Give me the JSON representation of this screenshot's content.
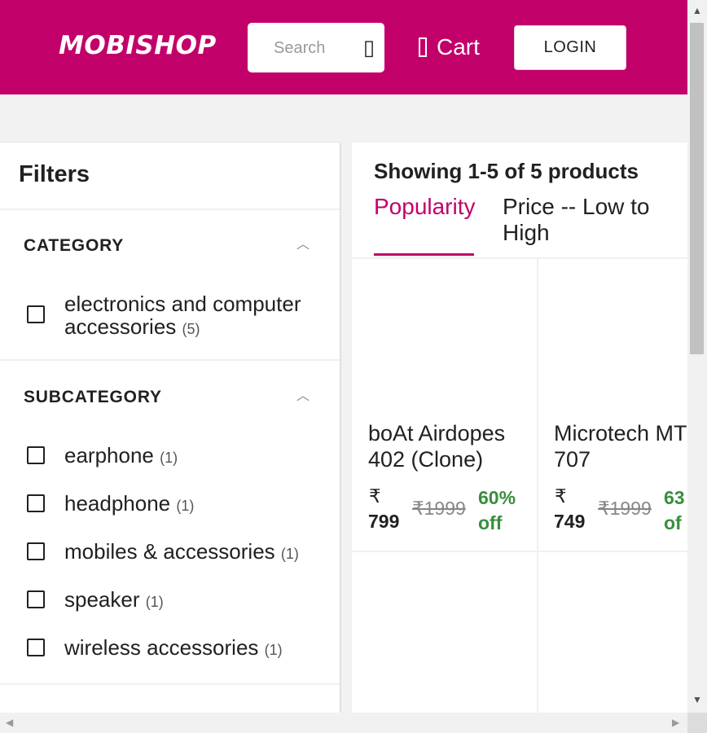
{
  "header": {
    "logo": "MOBISHOP",
    "search_placeholder": "Search",
    "search_icon_glyph": "▯",
    "cart_label": "Cart",
    "login_label": "LOGIN",
    "brand_color": "#c2006a"
  },
  "filters": {
    "title": "Filters",
    "category": {
      "title": "CATEGORY",
      "options": [
        {
          "line1": "electronics and computer",
          "line2": "accessories",
          "count": "(5)"
        }
      ]
    },
    "subcategory": {
      "title": "SUBCATEGORY",
      "options": [
        {
          "label": "earphone",
          "count": "(1)"
        },
        {
          "label": "headphone",
          "count": "(1)"
        },
        {
          "label": "mobiles & accessories",
          "count": "(1)"
        },
        {
          "label": "speaker",
          "count": "(1)"
        },
        {
          "label": "wireless accessories",
          "count": "(1)"
        }
      ]
    }
  },
  "products": {
    "showing": "Showing 1-5 of 5 products",
    "sort_tabs": [
      "Popularity",
      "Price -- Low to High"
    ],
    "active_tab": "Popularity",
    "items": [
      {
        "name_line1": "boAt Airdopes",
        "name_line2": "402 (Clone)",
        "currency": "₹",
        "price": "799",
        "mrp": "₹1999",
        "discount_line1": "60%",
        "discount_line2": "off"
      },
      {
        "name_line1": "Microtech MT",
        "name_line2": "707",
        "currency": "₹",
        "price": "749",
        "mrp": "₹1999",
        "discount_line1": "63",
        "discount_line2": "of"
      }
    ],
    "discount_color": "#388e3c"
  }
}
